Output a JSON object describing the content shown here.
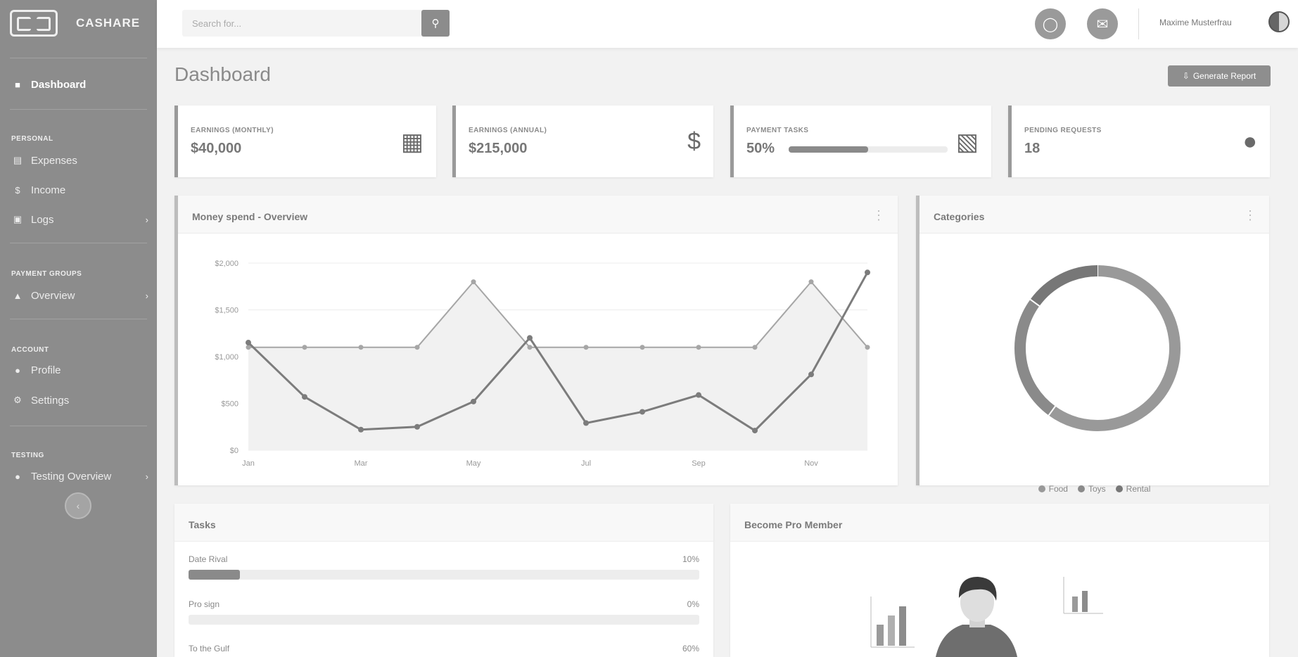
{
  "brand": {
    "name": "CASHARE"
  },
  "sidebar": {
    "dashboard": "Dashboard",
    "sections": [
      {
        "heading": "PERSONAL",
        "items": [
          "Expenses",
          "Income",
          "Logs"
        ]
      },
      {
        "heading": "PAYMENT GROUPS",
        "items": [
          "Overview"
        ]
      },
      {
        "heading": "ACCOUNT",
        "items": [
          "Profile",
          "Settings"
        ]
      },
      {
        "heading": "TESTING",
        "items": [
          "Testing Overview"
        ]
      }
    ]
  },
  "topbar": {
    "search_placeholder": "Search for...",
    "user_name": "Maxime Musterfrau"
  },
  "page": {
    "title": "Dashboard",
    "report_button": "Generate Report"
  },
  "stats": [
    {
      "label": "EARNINGS (MONTHLY)",
      "value": "$40,000",
      "icon": "calendar-icon"
    },
    {
      "label": "EARNINGS (ANNUAL)",
      "value": "$215,000",
      "icon": "dollar-icon"
    },
    {
      "label": "PAYMENT TASKS",
      "value": "50%",
      "progress": 0.5,
      "icon": "clipboard-icon"
    },
    {
      "label": "PENDING REQUESTS",
      "value": "18",
      "icon": "comments-icon"
    }
  ],
  "overview_card": {
    "title": "Money spend - Overview"
  },
  "categories_card": {
    "title": "Categories"
  },
  "tasks_card": {
    "title": "Tasks",
    "items": [
      {
        "label": "Date Rival",
        "percent": "10%",
        "progress": 0.1
      },
      {
        "label": "Pro sign",
        "percent": "0%",
        "progress": 0
      },
      {
        "label": "To the Gulf",
        "percent": "60%",
        "progress": 0.6
      }
    ]
  },
  "promo_card": {
    "title": "Become Pro Member"
  },
  "chart_data": [
    {
      "type": "line",
      "yticks": [
        "$0",
        "$500",
        "$1,000",
        "$1,500",
        "$2,000"
      ],
      "xticks": [
        "Jan",
        "Mar",
        "May",
        "Jul",
        "Sep",
        "Nov"
      ],
      "ylim": [
        0,
        2000
      ],
      "x": [
        "Jan",
        "Feb",
        "Mar",
        "Apr",
        "May",
        "Jun",
        "Jul",
        "Aug",
        "Sep",
        "Oct",
        "Nov",
        "Dec"
      ],
      "series": [
        {
          "values": [
            1100,
            1100,
            1100,
            1100,
            1800,
            1100,
            1100,
            1100,
            1100,
            1100,
            1800,
            1100
          ],
          "color": "#a6a6a6"
        },
        {
          "values": [
            1150,
            570,
            220,
            250,
            520,
            1200,
            290,
            410,
            590,
            210,
            810,
            1900
          ],
          "color": "#7c7c7c"
        }
      ],
      "grid": true
    },
    {
      "type": "pie",
      "style": "doughnut",
      "labels": [
        "Food",
        "Toys",
        "Rental"
      ],
      "values": [
        60,
        25,
        15
      ],
      "colors": [
        "#999999",
        "#8a8a8a",
        "#777777"
      ],
      "legend": "bottom"
    }
  ]
}
